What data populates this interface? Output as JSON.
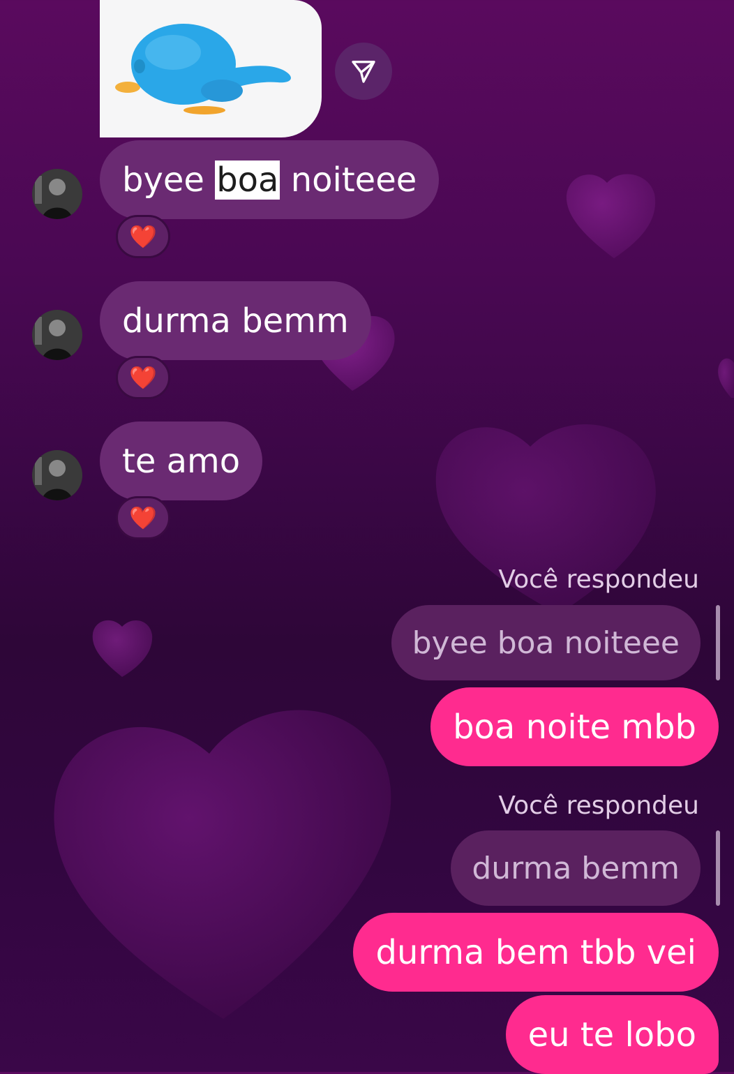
{
  "incoming": [
    {
      "pre": "byee ",
      "highlight": "boa",
      "post": " noiteee",
      "reaction": "❤️"
    },
    {
      "text": "durma bemm",
      "reaction": "❤️"
    },
    {
      "text": "te amo",
      "reaction": "❤️"
    }
  ],
  "replies": [
    {
      "label": "Você respondeu",
      "quoted": "byee boa noiteee",
      "message": "boa noite mbb"
    },
    {
      "label": "Você respondeu",
      "quoted": "durma bemm",
      "message": "durma bem tbb vei"
    }
  ],
  "last_message": "eu te lobo",
  "colors": {
    "background": "#3a0745",
    "incoming_bubble": "#6a2a72",
    "outgoing_bubble": "#ff2b8f",
    "quoted_bubble": "#5a215f"
  },
  "icons": {
    "share": "paper-plane-icon",
    "reaction": "heart-emoji"
  }
}
